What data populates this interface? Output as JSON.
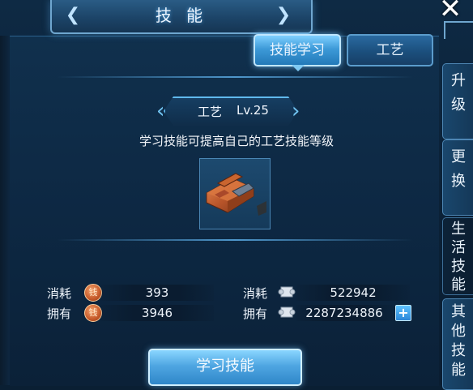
{
  "window": {
    "title": "技 能",
    "close_label": "✕"
  },
  "tabs": [
    {
      "label": "技能学习",
      "active": true
    },
    {
      "label": "工艺",
      "active": false
    }
  ],
  "skill": {
    "name": "工艺",
    "level": "Lv.25",
    "description": "学习技能可提高自己的工艺技能等级",
    "icon": "plane-tool-icon"
  },
  "costs": [
    {
      "label": "消耗",
      "currency_icon": "copper-coin-icon",
      "value": "393"
    },
    {
      "label": "消耗",
      "currency_icon": "scroll-icon",
      "value": "522942"
    }
  ],
  "owned": [
    {
      "label": "拥有",
      "currency_icon": "copper-coin-icon",
      "value": "3946"
    },
    {
      "label": "拥有",
      "currency_icon": "scroll-icon",
      "value": "2287234886"
    }
  ],
  "add_button_label": "+",
  "learn_button_label": "学习技能",
  "side_tabs": [
    {
      "chars": [
        "升",
        "级"
      ],
      "active": false
    },
    {
      "chars": [
        "更",
        "换"
      ],
      "active": false
    },
    {
      "chars": [
        "生",
        "活",
        "技",
        "能"
      ],
      "active": true
    },
    {
      "chars": [
        "其",
        "他",
        "技",
        "能"
      ],
      "active": false
    }
  ],
  "colors": {
    "accent": "#3d9ad8",
    "panel": "#0d2843",
    "coin": "#c65a2a"
  }
}
